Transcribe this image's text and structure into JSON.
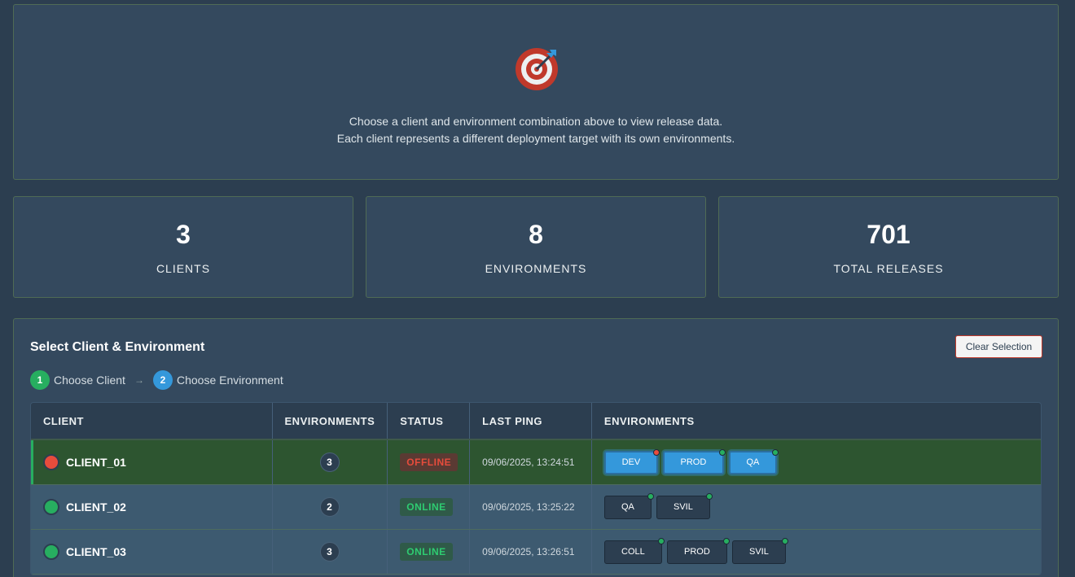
{
  "hero": {
    "icon": "target-icon",
    "line1": "Choose a client and environment combination above to view release data.",
    "line2": "Each client represents a different deployment target with its own environments."
  },
  "stats": [
    {
      "value": "3",
      "label": "CLIENTS"
    },
    {
      "value": "8",
      "label": "ENVIRONMENTS"
    },
    {
      "value": "701",
      "label": "TOTAL RELEASES"
    }
  ],
  "selection": {
    "title": "Select Client & Environment",
    "clear_label": "Clear Selection",
    "steps": [
      {
        "num": "1",
        "label": "Choose Client",
        "color": "#27ae60"
      },
      {
        "num": "2",
        "label": "Choose Environment",
        "color": "#3498db"
      }
    ],
    "arrow": "→"
  },
  "table": {
    "headers": [
      "CLIENT",
      "ENVIRONMENTS",
      "STATUS",
      "LAST PING",
      "ENVIRONMENTS"
    ],
    "rows": [
      {
        "client": "CLIENT_01",
        "count": "3",
        "status": "OFFLINE",
        "last_ping": "09/06/2025, 13:24:51",
        "envs": [
          "DEV",
          "PROD",
          "QA"
        ]
      },
      {
        "client": "CLIENT_02",
        "count": "2",
        "status": "ONLINE",
        "last_ping": "09/06/2025, 13:25:22",
        "envs": [
          "QA",
          "SVIL"
        ]
      },
      {
        "client": "CLIENT_03",
        "count": "3",
        "status": "ONLINE",
        "last_ping": "09/06/2025, 13:26:51",
        "envs": [
          "COLL",
          "PROD",
          "SVIL"
        ]
      }
    ]
  },
  "colors": {
    "online": "#27ae60",
    "offline": "#e74c3c",
    "accent": "#3498db"
  }
}
